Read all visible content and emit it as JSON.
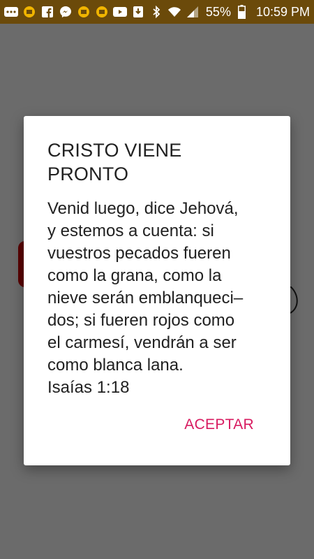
{
  "status_bar": {
    "icons": [
      "more-icon",
      "app-icon",
      "facebook-icon",
      "messenger-icon",
      "app-icon",
      "app-icon",
      "youtube-icon",
      "download-icon",
      "bluetooth-icon",
      "wifi-icon",
      "signal-icon",
      "battery-icon"
    ],
    "battery_percent": "55%",
    "time": "10:59 PM"
  },
  "dialog": {
    "title": "CRISTO VIENE PRONTO",
    "message": "Venid luego, dice Jehová,\ny estemos a cuenta: si\nvuestros pecados fueren\ncomo la grana, como la\nnieve serán emblanqueci–\ndos; si fueren rojos como\nel carmesí, vendrán a ser\ncomo blanca lana.\nIsaías 1:18",
    "accept_label": "ACEPTAR"
  },
  "colors": {
    "status_bar": "#6b4a0a",
    "scrim": "#6b6b6b",
    "accent": "#d81b60"
  }
}
